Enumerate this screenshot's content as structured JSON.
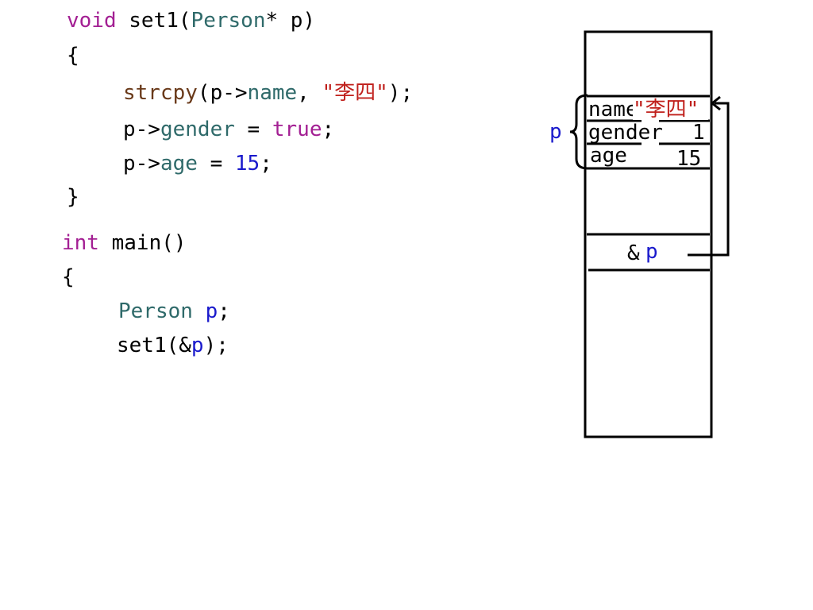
{
  "code": {
    "set1_sig": {
      "kw": "void",
      "name": " set1(",
      "type": "Person",
      "rest": "* p)"
    },
    "open1": "{",
    "line_strcpy": {
      "fn": "strcpy",
      "p1": "(p->",
      "mem": "name",
      "p2": ", ",
      "str": "\"李四\"",
      "p3": ");"
    },
    "line_gender": {
      "p1": "p->",
      "mem": "gender",
      "p2": " = ",
      "kw": "true",
      "p3": ";"
    },
    "line_age": {
      "p1": "p->",
      "mem": "age",
      "p2": " = ",
      "num": "15",
      "p3": ";"
    },
    "close1": "}",
    "main_sig": {
      "kw": "int",
      "rest": " main()"
    },
    "open2": "{",
    "line_decl": {
      "type": "Person",
      "sp": " ",
      "var": "p",
      "semi": ";"
    },
    "line_call": {
      "p1": "set1(&",
      "var": "p",
      "p2": ");"
    }
  },
  "memory": {
    "pointer_label": "p",
    "name_label": "name",
    "name_value": "\"李四\"",
    "gender_label": "gender",
    "gender_value": "1",
    "age_label": "age",
    "age_value": "15",
    "addr_amp": "&",
    "addr_var": "p"
  }
}
